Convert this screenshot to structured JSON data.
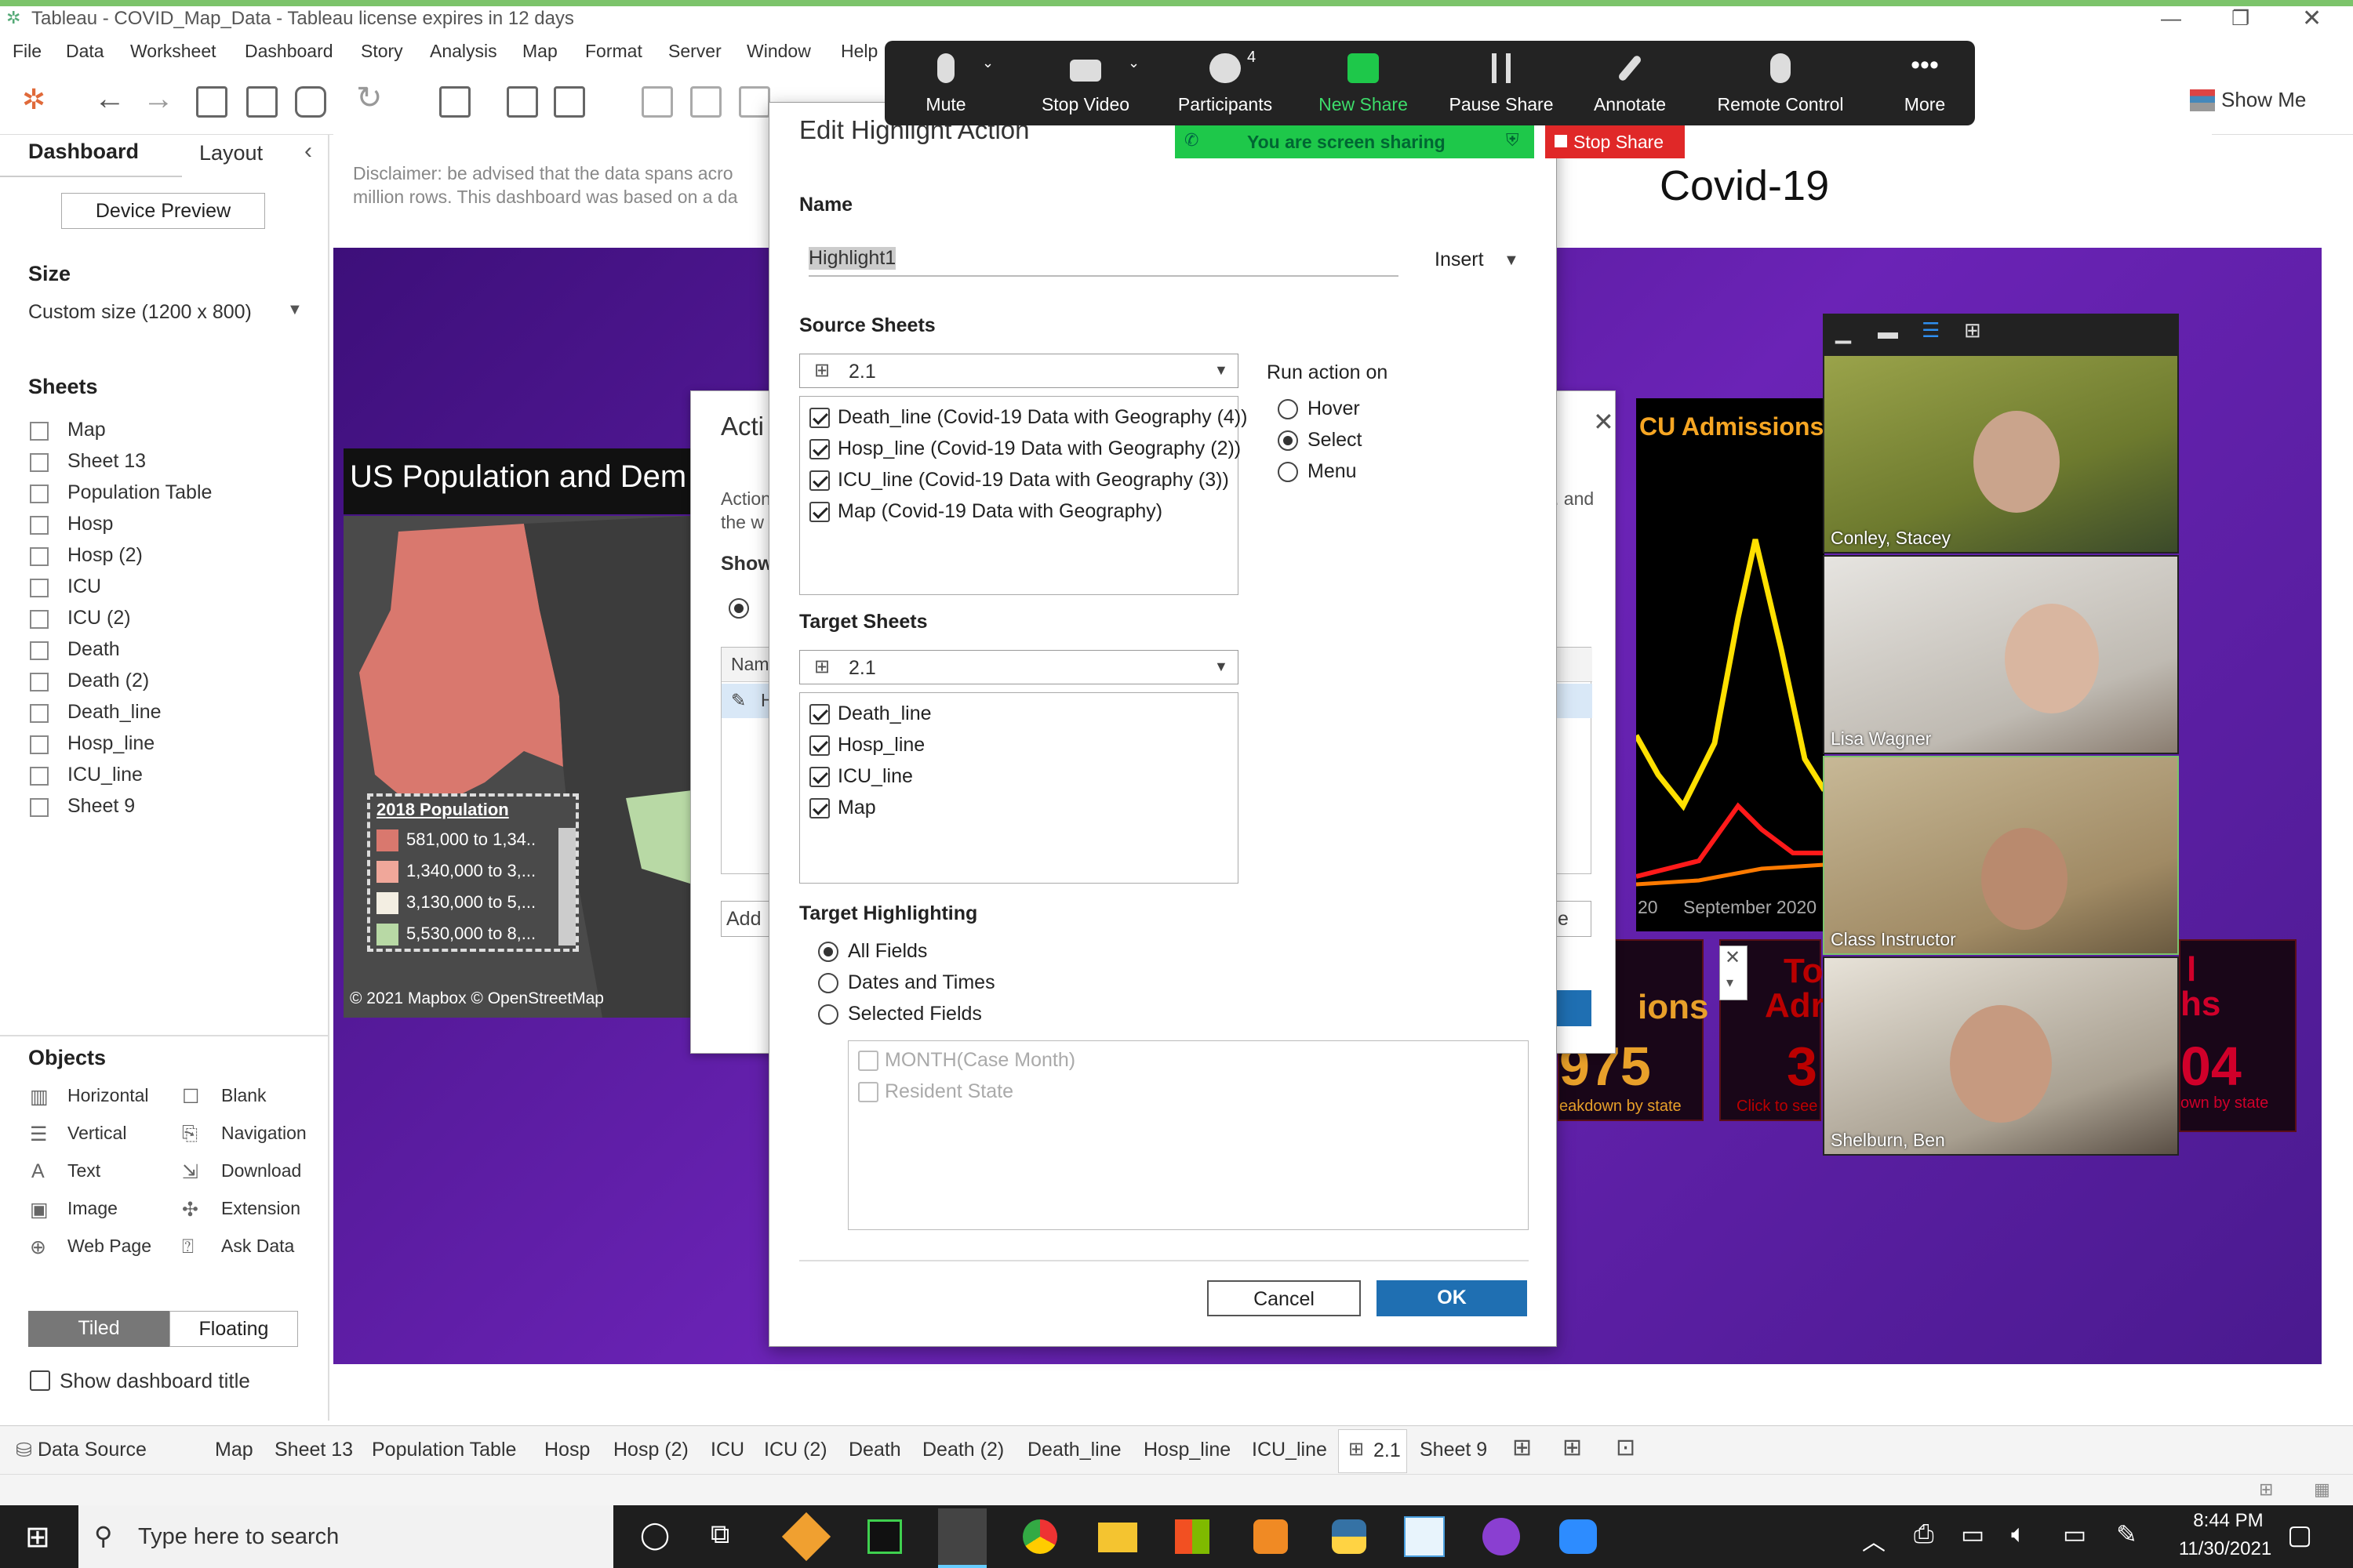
{
  "window": {
    "title": "Tableau - COVID_Map_Data - Tableau license expires in 12 days"
  },
  "menu": [
    "File",
    "Data",
    "Worksheet",
    "Dashboard",
    "Story",
    "Analysis",
    "Map",
    "Format",
    "Server",
    "Window",
    "Help"
  ],
  "toolbar": {
    "show_me": "Show Me"
  },
  "side": {
    "tab_dashboard": "Dashboard",
    "tab_layout": "Layout",
    "device_preview": "Device Preview",
    "size_title": "Size",
    "size_value": "Custom size (1200 x 800)",
    "sheets_title": "Sheets",
    "sheets": [
      "Map",
      "Sheet 13",
      "Population Table",
      "Hosp",
      "Hosp (2)",
      "ICU",
      "ICU (2)",
      "Death",
      "Death (2)",
      "Death_line",
      "Hosp_line",
      "ICU_line",
      "Sheet 9"
    ],
    "objects_title": "Objects",
    "objects": [
      [
        "Horizontal",
        "Blank"
      ],
      [
        "Vertical",
        "Navigation"
      ],
      [
        "Text",
        "Download"
      ],
      [
        "Image",
        "Extension"
      ],
      [
        "Web Page",
        "Ask Data"
      ]
    ],
    "tiled": "Tiled",
    "floating": "Floating",
    "show_title": "Show dashboard title"
  },
  "dashboard": {
    "disclaimer_1": "Disclaimer: be advised that the data spans acro",
    "disclaimer_2": "million rows. This dashboard was based on a da",
    "title": "Covid-19",
    "map_title": "US Population and Dem",
    "legend_title": "2018 Population",
    "legend": [
      "581,000 to 1,34..",
      "1,340,000 to 3,...",
      "3,130,000 to 5,...",
      "5,530,000 to 8,..."
    ],
    "legend_colors": [
      "#d9786e",
      "#f0a79a",
      "#f3eee2",
      "#b8d9a5"
    ],
    "map_credit": "© 2021 Mapbox © OpenStreetMap",
    "icu_title": "CU Admissions,",
    "chart_axis": "September 2020",
    "chart_axis_left": "20",
    "kpi1_big": "975",
    "kpi1_word": "ions",
    "kpi1_sub": "eakdown by state",
    "kpi2_a": "To",
    "kpi2_b": "Adr",
    "kpi2_big": "3",
    "kpi2_sub": "Click to see",
    "kpi3_a": "l",
    "kpi3_b": "hs",
    "kpi3_big": "04",
    "kpi3_sub": "own by state"
  },
  "actions_dialog": {
    "title": "Acti",
    "desc_1": "Action",
    "desc_2": "the w",
    "desc_3": ". and",
    "show": "Show",
    "col_name": "Nam",
    "add": "Add",
    "row_marker": "H",
    "btn_fragment": "e"
  },
  "zoom": {
    "buttons": [
      "Mute",
      "Stop Video",
      "Participants",
      "New Share",
      "Pause Share",
      "Annotate",
      "Remote Control",
      "More"
    ],
    "participants_count": "4",
    "sharing_banner": "You are screen sharing",
    "stop_share": "Stop Share",
    "people": [
      "Conley, Stacey",
      "Lisa Wagner",
      "Class Instructor",
      "Shelburn, Ben"
    ]
  },
  "edit_dialog": {
    "title": "Edit Highlight Action",
    "name_label": "Name",
    "name_value": "Highlight1",
    "insert": "Insert",
    "source_label": "Source Sheets",
    "source_combo": "2.1",
    "source_items": [
      "Death_line (Covid-19 Data with Geography (4))",
      "Hosp_line (Covid-19 Data with Geography (2))",
      "ICU_line (Covid-19 Data with Geography (3))",
      "Map (Covid-19 Data with Geography)"
    ],
    "run_label": "Run action on",
    "run_options": [
      "Hover",
      "Select",
      "Menu"
    ],
    "target_label": "Target Sheets",
    "target_combo": "2.1",
    "target_items": [
      "Death_line",
      "Hosp_line",
      "ICU_line",
      "Map"
    ],
    "highlight_label": "Target Highlighting",
    "highlight_options": [
      "All Fields",
      "Dates and Times",
      "Selected Fields"
    ],
    "fields": [
      "MONTH(Case Month)",
      "Resident State"
    ],
    "cancel": "Cancel",
    "ok": "OK"
  },
  "tabs": [
    "Data Source",
    "Map",
    "Sheet 13",
    "Population Table",
    "Hosp",
    "Hosp (2)",
    "ICU",
    "ICU (2)",
    "Death",
    "Death (2)",
    "Death_line",
    "Hosp_line",
    "ICU_line",
    "2.1",
    "Sheet 9"
  ],
  "taskbar": {
    "search": "Type here to search",
    "time": "8:44 PM",
    "date": "11/30/2021"
  }
}
